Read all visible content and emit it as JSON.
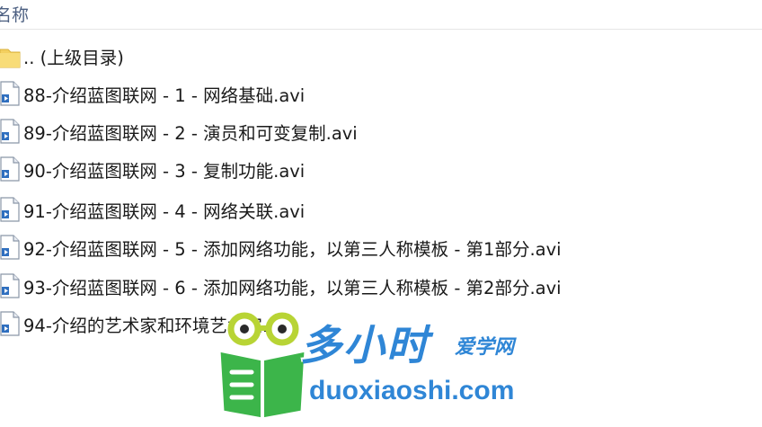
{
  "explorer": {
    "column_header": "名称",
    "files": [
      {
        "name": ".. (上级目录)",
        "icon": "folder-icon"
      },
      {
        "name": "88-介绍蓝图联网 - 1 - 网络基础.avi",
        "icon": "video-file-icon"
      },
      {
        "name": "89-介绍蓝图联网 - 2 - 演员和可变复制.avi",
        "icon": "video-file-icon"
      },
      {
        "name": "90-介绍蓝图联网 - 3 - 复制功能.avi",
        "icon": "video-file-icon"
      },
      {
        "name": "91-介绍蓝图联网 - 4 - 网络关联.avi",
        "icon": "video-file-icon"
      },
      {
        "name": "92-介绍蓝图联网 - 5 - 添加网络功能，以第三人称模板 - 第1部分.avi",
        "icon": "video-file-icon"
      },
      {
        "name": "93-介绍蓝图联网 - 6 - 添加网络功能，以第三人称模板 - 第2部分.avi",
        "icon": "video-file-icon"
      },
      {
        "name": "94-介绍的艺术家和环境艺术家.avi",
        "icon": "video-file-icon"
      }
    ]
  },
  "watermark": {
    "brand": "多小时",
    "sub": "爱学网",
    "domain": "duoxiaoshi.com",
    "colors": {
      "blue": "#2f86d6",
      "green": "#3cb54a",
      "yellow": "#f2e130"
    }
  }
}
